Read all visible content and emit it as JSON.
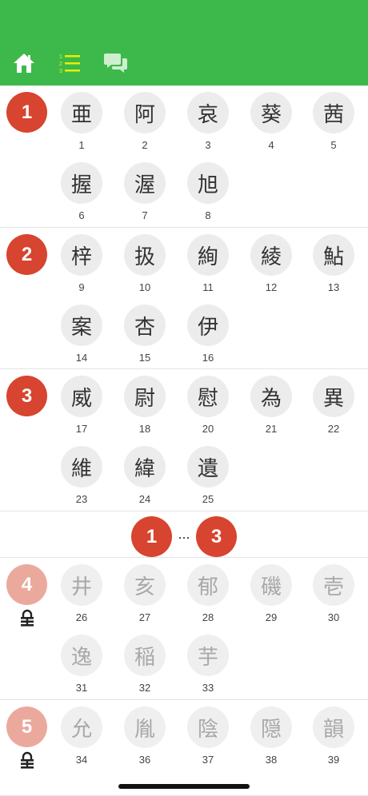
{
  "header": {
    "background": "#3cb94a",
    "icons": [
      "home-icon",
      "list-icon",
      "chat-icon"
    ]
  },
  "accent": "#d7442f",
  "sections": [
    {
      "number": "1",
      "locked": false,
      "items": [
        {
          "kanji": "亜",
          "num": "1"
        },
        {
          "kanji": "阿",
          "num": "2"
        },
        {
          "kanji": "哀",
          "num": "3"
        },
        {
          "kanji": "葵",
          "num": "4"
        },
        {
          "kanji": "茜",
          "num": "5"
        },
        {
          "kanji": "握",
          "num": "6"
        },
        {
          "kanji": "渥",
          "num": "7"
        },
        {
          "kanji": "旭",
          "num": "8"
        }
      ]
    },
    {
      "number": "2",
      "locked": false,
      "items": [
        {
          "kanji": "梓",
          "num": "9"
        },
        {
          "kanji": "扱",
          "num": "10"
        },
        {
          "kanji": "絢",
          "num": "11"
        },
        {
          "kanji": "綾",
          "num": "12"
        },
        {
          "kanji": "鮎",
          "num": "13"
        },
        {
          "kanji": "案",
          "num": "14"
        },
        {
          "kanji": "杏",
          "num": "15"
        },
        {
          "kanji": "伊",
          "num": "16"
        }
      ]
    },
    {
      "number": "3",
      "locked": false,
      "items": [
        {
          "kanji": "威",
          "num": "17"
        },
        {
          "kanji": "尉",
          "num": "18"
        },
        {
          "kanji": "慰",
          "num": "20"
        },
        {
          "kanji": "為",
          "num": "21"
        },
        {
          "kanji": "異",
          "num": "22"
        },
        {
          "kanji": "維",
          "num": "23"
        },
        {
          "kanji": "緯",
          "num": "24"
        },
        {
          "kanji": "遺",
          "num": "25"
        }
      ]
    },
    {
      "number": "4",
      "locked": true,
      "items": [
        {
          "kanji": "井",
          "num": "26"
        },
        {
          "kanji": "亥",
          "num": "27"
        },
        {
          "kanji": "郁",
          "num": "28"
        },
        {
          "kanji": "磯",
          "num": "29"
        },
        {
          "kanji": "壱",
          "num": "30"
        },
        {
          "kanji": "逸",
          "num": "31"
        },
        {
          "kanji": "稲",
          "num": "32"
        },
        {
          "kanji": "芋",
          "num": "33"
        }
      ]
    },
    {
      "number": "5",
      "locked": true,
      "items": [
        {
          "kanji": "允",
          "num": "34"
        },
        {
          "kanji": "胤",
          "num": "36"
        },
        {
          "kanji": "陰",
          "num": "37"
        },
        {
          "kanji": "隠",
          "num": "38"
        },
        {
          "kanji": "韻",
          "num": "39"
        }
      ]
    }
  ],
  "pager": {
    "first": "1",
    "ellipsis": "...",
    "last": "3"
  }
}
